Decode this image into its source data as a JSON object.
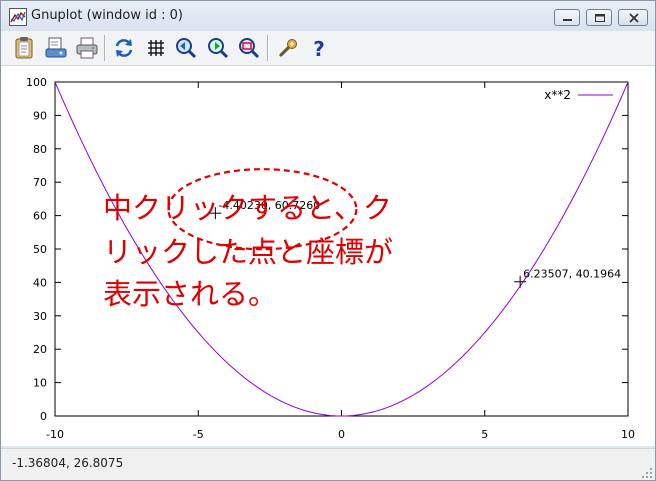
{
  "window": {
    "title": "Gnuplot (window id : 0)"
  },
  "toolbar": {
    "items": [
      {
        "icon": "clipboard-icon"
      },
      {
        "icon": "print-preview-icon"
      },
      {
        "icon": "printer-icon"
      },
      {
        "icon": "replot-icon"
      },
      {
        "icon": "grid-icon"
      },
      {
        "icon": "zoom-previous-icon"
      },
      {
        "icon": "zoom-next-icon"
      },
      {
        "icon": "unzoom-icon"
      },
      {
        "icon": "options-icon"
      },
      {
        "icon": "help-icon"
      }
    ]
  },
  "chart_data": {
    "type": "line",
    "function": "x**2",
    "series": [
      {
        "name": "x**2",
        "color": "#9400d3"
      }
    ],
    "xlim": [
      -10,
      10
    ],
    "ylim": [
      0,
      100
    ],
    "xticks": [
      "-10",
      "-5",
      "0",
      "5",
      "10"
    ],
    "yticks": [
      "0",
      "10",
      "20",
      "30",
      "40",
      "50",
      "60",
      "70",
      "80",
      "90",
      "100"
    ],
    "legend": "top-right",
    "grid": false,
    "marks": [
      {
        "x": -4.4023,
        "y": 60.726,
        "label": "-4.40230,  60.7260"
      },
      {
        "x": 6.23507,
        "y": 40.1964,
        "label": "6.23507,  40.1964"
      }
    ]
  },
  "annotation": {
    "color": "#e00000",
    "lines": [
      "中クリックすると、ク",
      "リックした点と座標が",
      "表示される。"
    ]
  },
  "status": {
    "text": "-1.36804,  26.8075"
  }
}
